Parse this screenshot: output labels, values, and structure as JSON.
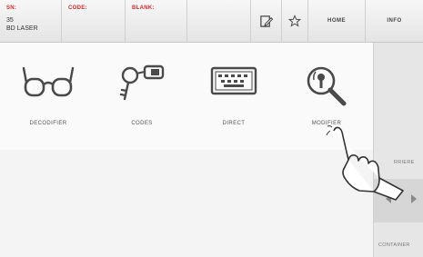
{
  "header": {
    "sn_label": "SN:",
    "sn_value_line1": "35",
    "sn_value_line2": "BD LASER",
    "code_label": "CODE:",
    "blank_label": "BLANK:",
    "home_label": "HOME",
    "info_label": "INFO",
    "edit_icon": "edit-icon",
    "favorite_icon": "star-icon"
  },
  "tiles": [
    {
      "label": "DECODIFIER",
      "icon": "glasses-icon"
    },
    {
      "label": "CODES",
      "icon": "key-tag-icon"
    },
    {
      "label": "DIRECT",
      "icon": "keyboard-icon"
    },
    {
      "label": "MODIFIER",
      "icon": "magnifier-key-icon"
    }
  ],
  "rightpanel": {
    "back_label": "RRIERE",
    "container_label": "CONTAINER"
  },
  "colors": {
    "accent_red": "#d42a2a",
    "icon_gray": "#4a4a4a"
  }
}
